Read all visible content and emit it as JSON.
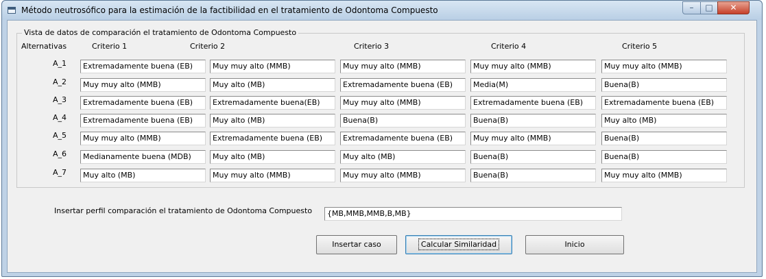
{
  "window": {
    "title": "Método neutrosófico para la estimación de la factibilidad en el tratamiento de Odontoma Compuesto",
    "controls": {
      "minimize": "–",
      "maximize": "□",
      "close": "✕"
    }
  },
  "group": {
    "title": "Vista de datos de comparación  el tratamiento de Odontoma Compuesto"
  },
  "headers": {
    "alternatives": "Alternativas",
    "criteria": [
      "Criterio 1",
      "Criterio 2",
      "Criterio 3",
      "Criterio 4",
      "Criterio 5"
    ]
  },
  "rows": [
    {
      "label": "A_1",
      "values": [
        "Extremadamente buena (EB)",
        "Muy muy alto (MMB)",
        "Muy muy alto (MMB)",
        "Muy muy alto (MMB)",
        "Muy muy alto (MMB)"
      ]
    },
    {
      "label": "A_2",
      "values": [
        "Muy muy alto (MMB)",
        "Muy alto (MB)",
        "Extremadamente buena (EB)",
        "Media(M)",
        "Buena(B)"
      ]
    },
    {
      "label": "A_3",
      "values": [
        "Extremadamente buena (EB)",
        "Extremadamente buena(EB)",
        "Muy muy alto (MMB)",
        "Extremadamente buena (EB)",
        "Extremadamente buena (EB)"
      ]
    },
    {
      "label": "A_4",
      "values": [
        "Extremadamente buena (EB)",
        "Muy alto (MB)",
        "Buena(B)",
        "Buena(B)",
        "Muy alto (MB)"
      ]
    },
    {
      "label": "A_5",
      "values": [
        "Muy muy alto (MMB)",
        "Extremadamente buena (EB)",
        "Extremadamente buena (EB)",
        "Muy muy alto (MMB)",
        "Buena(B)"
      ]
    },
    {
      "label": "A_6",
      "values": [
        "Medianamente buena (MDB)",
        "Muy alto (MB)",
        "Muy alto (MB)",
        "Buena(B)",
        "Buena(B)"
      ]
    },
    {
      "label": "A_7",
      "values": [
        "Muy alto (MB)",
        "Muy muy alto (MMB)",
        "Muy muy alto (MMB)",
        "Buena(B)",
        "Muy muy alto (MMB)"
      ]
    }
  ],
  "profile": {
    "label": "Insertar perfil  comparación  el tratamiento de Odontoma Compuesto",
    "value": "{MB,MMB,MMB,B,MB}"
  },
  "buttons": {
    "insert": "Insertar caso",
    "calculate": "Calcular Similaridad",
    "home": "Inicio"
  }
}
